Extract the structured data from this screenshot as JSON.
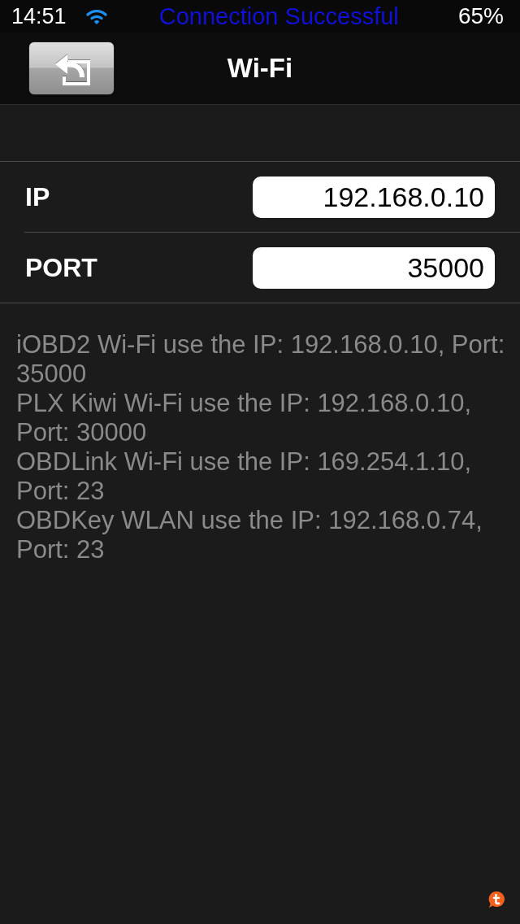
{
  "status_bar": {
    "time": "14:51",
    "message": "Connection Successful",
    "battery": "65%"
  },
  "nav_bar": {
    "title": "Wi-Fi"
  },
  "form": {
    "rows": [
      {
        "label": "IP",
        "value": "192.168.0.10"
      },
      {
        "label": "PORT",
        "value": "35000"
      }
    ]
  },
  "notes": [
    "iOBD2 Wi-Fi use the IP: 192.168.0.10, Port: 35000",
    "PLX Kiwi Wi-Fi use the IP: 192.168.0.10, Port: 30000",
    "OBDLink Wi-Fi use the IP: 169.254.1.10, Port: 23",
    "OBDKey WLAN use the IP: 192.168.0.74, Port: 23"
  ]
}
